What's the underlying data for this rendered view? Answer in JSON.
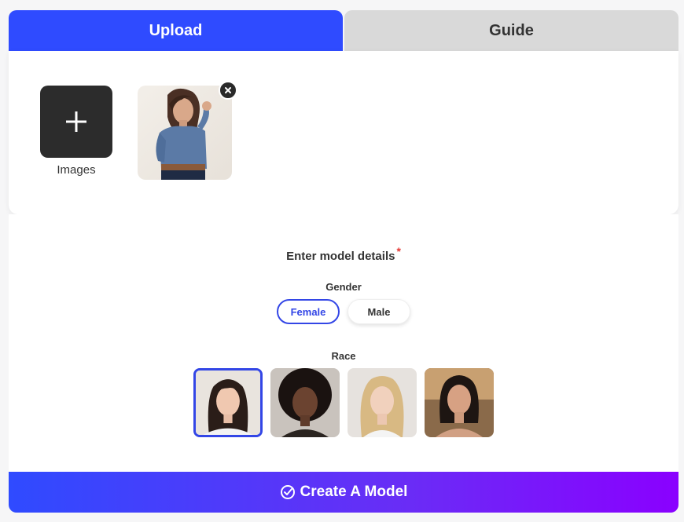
{
  "tabs": {
    "upload_label": "Upload",
    "guide_label": "Guide"
  },
  "upload": {
    "add_label": "Images"
  },
  "details": {
    "title": "Enter model details",
    "required_mark": "*",
    "gender_label": "Gender",
    "gender_options": [
      "Female",
      "Male"
    ],
    "gender_selected": "Female",
    "race_label": "Race",
    "race_selected_index": 0
  },
  "actions": {
    "create_label": "Create A Model"
  },
  "colors": {
    "accent": "#2f4bff",
    "gradient_end": "#8a00ff",
    "required": "#e53935"
  }
}
